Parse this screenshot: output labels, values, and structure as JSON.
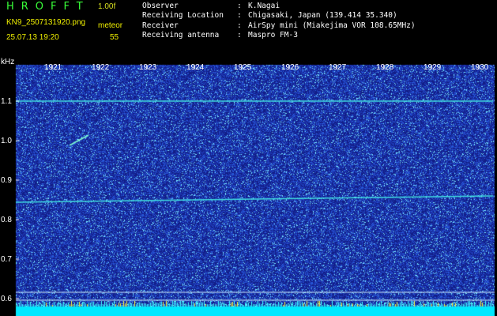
{
  "header": {
    "app_title": "HROFFT",
    "version": "1.00f",
    "filename": "KN9_2507131920.png",
    "meteor_label": "meteor",
    "datetime": "25.07.13 19:20",
    "meteor_count": "55"
  },
  "info": [
    {
      "key": "Observer",
      "sep": ":",
      "value": "K.Nagai"
    },
    {
      "key": "Receiving Location",
      "sep": ":",
      "value": "Chigasaki, Japan (139.414 35.340)"
    },
    {
      "key": "Receiver",
      "sep": ":",
      "value": "AirSpy mini (Miakejima VOR 108.65MHz)"
    },
    {
      "key": "Receiving antenna",
      "sep": ":",
      "value": "Maspro FM-3"
    }
  ],
  "spectrogram": {
    "y_unit": "kHz",
    "y_ticks": [
      "1.1",
      "1.0",
      "0.9",
      "0.8",
      "0.7",
      "0.6"
    ],
    "x_ticks": [
      "1921",
      "1922",
      "1923",
      "1924",
      "1925",
      "1926",
      "1927",
      "1928",
      "1929",
      "1930"
    ],
    "colors": {
      "background": "#1a2a9a",
      "noise_low": "#2848c8",
      "noise_high": "#40d0ff",
      "line": "#40e0e0",
      "baseline": "#00e8ff"
    }
  }
}
